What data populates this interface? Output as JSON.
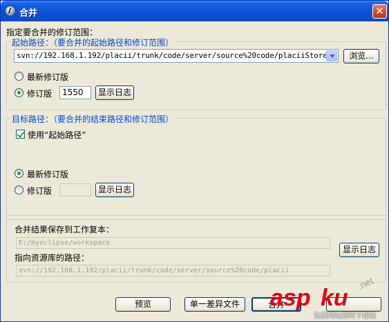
{
  "window": {
    "title": "合并"
  },
  "header": {
    "label": "指定要合并的修订范围："
  },
  "source": {
    "legend": "起始路径：（要合并的起始路径和修订范围）",
    "url": "svn://192.168.1.192/placii/trunk/code/server/source%20code/placiiStore",
    "browse_label": "浏览...",
    "latest_label": "最新修订版",
    "revision_label": "修订版",
    "revision_value": "1550",
    "show_log_label": "显示日志"
  },
  "target": {
    "legend": "目标路径：（要合并的结束路径和修订范围）",
    "use_from_label": "使用“起始路径”",
    "latest_label": "最新修订版",
    "revision_label": "修订版",
    "revision_value": "",
    "show_log_label": "显示日志"
  },
  "result": {
    "save_label": "合并结果保存到工作复本：",
    "working_copy": "E:/myeclipse/workspace",
    "repo_label": "指向资源库的路径：",
    "repo_path": "svn://192.168.1.192/placii/trunk/code/server/source%20code/placii",
    "show_log_label": "显示日志"
  },
  "footer": {
    "preview_label": "预览",
    "unified_diff_label": "单一差异文件",
    "merge_label": "合并"
  },
  "watermark": {
    "brand": "asp",
    "brand_tail": "ku",
    "domain": ".net",
    "subtitle": "免费网站源码下载站"
  },
  "colors": {
    "accent": "#0046d5",
    "titlebar": "#0a52d6",
    "close": "#d24a2b",
    "watermark": "#e60012"
  }
}
